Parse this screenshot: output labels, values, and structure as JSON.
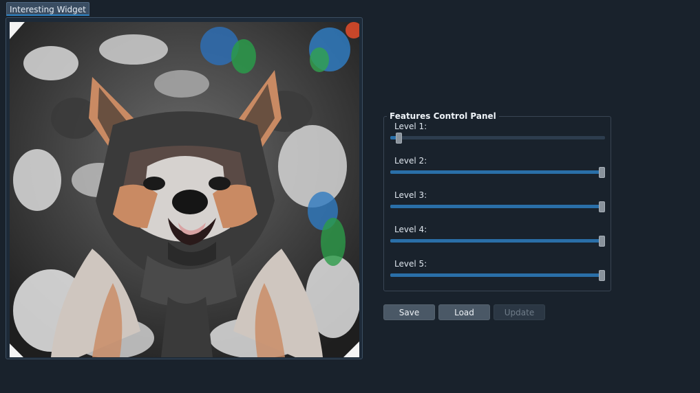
{
  "tab": {
    "label": "Interesting Widget"
  },
  "image": {
    "alt_icon": "stylized-dog-image"
  },
  "panel": {
    "title": "Features Control Panel",
    "levels": [
      {
        "label": "Level 1:",
        "value": 0.04
      },
      {
        "label": "Level 2:",
        "value": 0.985
      },
      {
        "label": "Level 3:",
        "value": 0.985
      },
      {
        "label": "Level 4:",
        "value": 0.985
      },
      {
        "label": "Level 5:",
        "value": 0.985
      }
    ]
  },
  "buttons": {
    "save": "Save",
    "load": "Load",
    "update": "Update"
  },
  "colors": {
    "background": "#19222c",
    "accent": "#2a6fa8",
    "tab_underline": "#2f86c8"
  }
}
